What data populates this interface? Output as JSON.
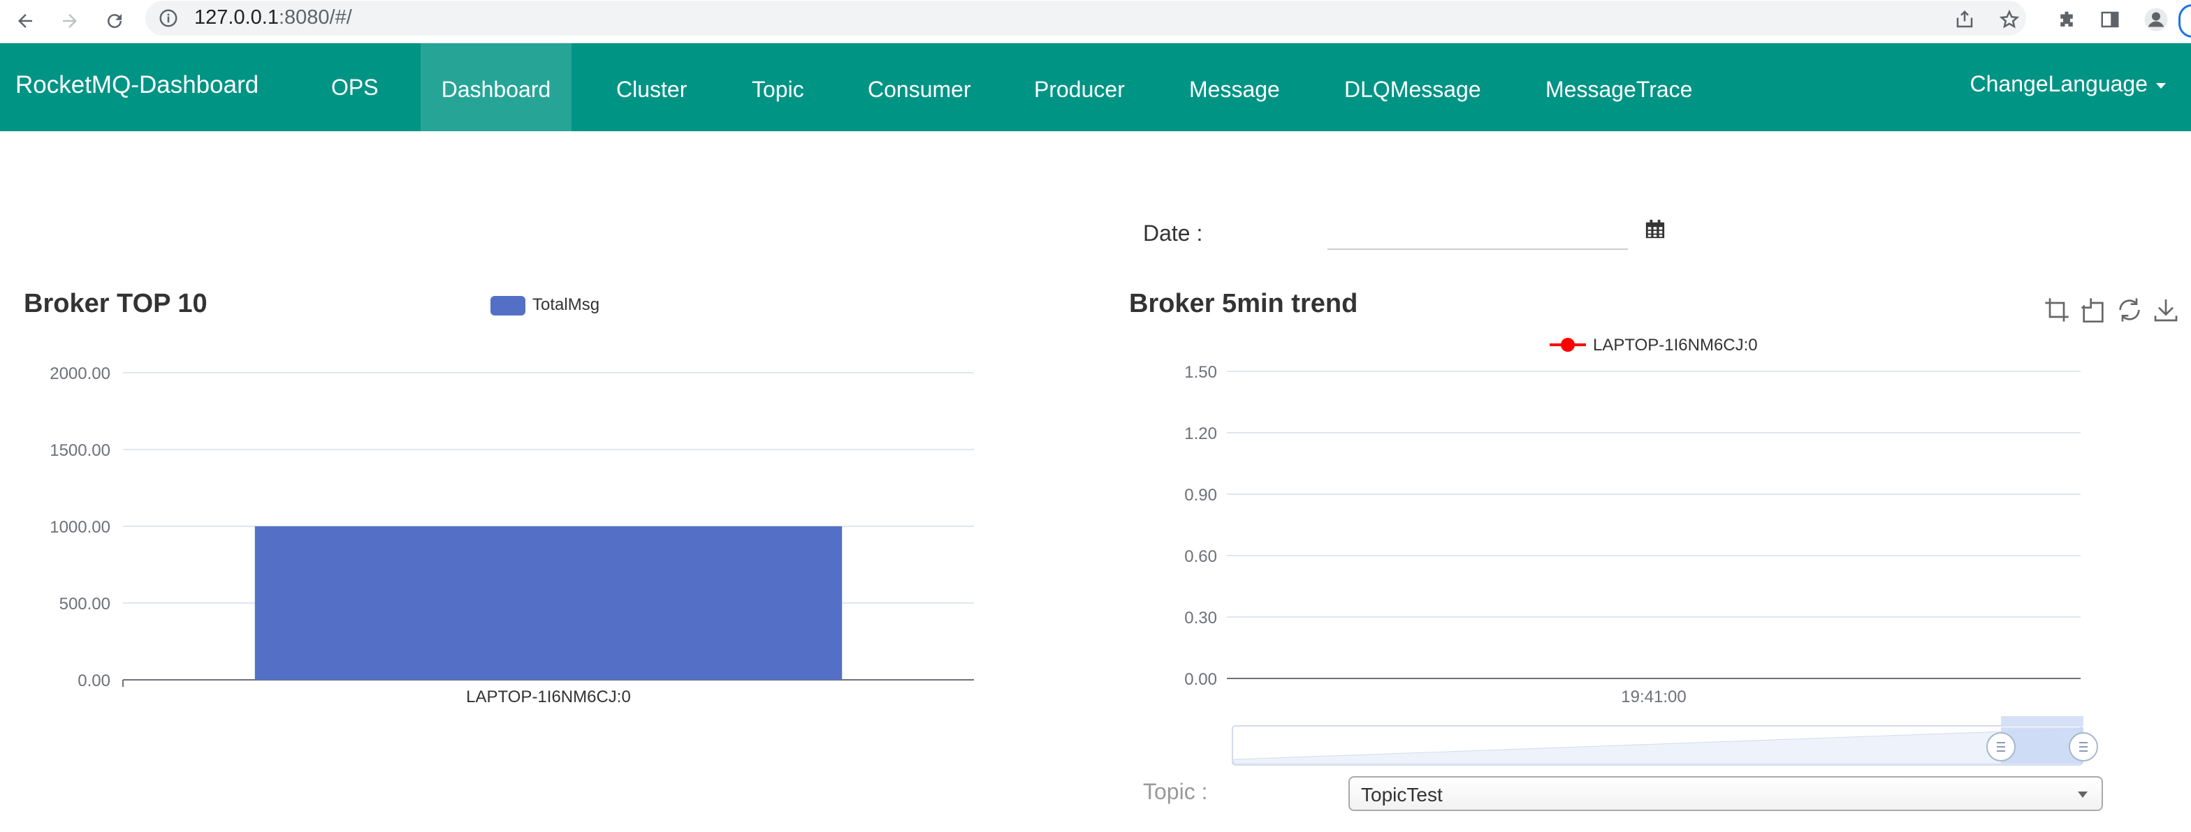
{
  "browser": {
    "url_host": "127.0.0.1",
    "url_rest": ":8080/#/"
  },
  "nav": {
    "brand": "RocketMQ-Dashboard",
    "items": [
      {
        "label": "OPS",
        "name": "nav-ops"
      },
      {
        "label": "Dashboard",
        "name": "nav-dashboard"
      },
      {
        "label": "Cluster",
        "name": "nav-cluster"
      },
      {
        "label": "Topic",
        "name": "nav-topic"
      },
      {
        "label": "Consumer",
        "name": "nav-consumer"
      },
      {
        "label": "Producer",
        "name": "nav-producer"
      },
      {
        "label": "Message",
        "name": "nav-message"
      },
      {
        "label": "DLQMessage",
        "name": "nav-dlqmessage"
      },
      {
        "label": "MessageTrace",
        "name": "nav-messagetrace"
      }
    ],
    "active": "Dashboard",
    "language": "ChangeLanguage"
  },
  "date": {
    "label": "Date :",
    "value": ""
  },
  "topic": {
    "label": "Topic :",
    "selected": "TopicTest"
  },
  "colors": {
    "navbar": "#009485",
    "nav_active": "#26a597",
    "bar": "#5470c6",
    "line": "#ff0000"
  },
  "chart_data": [
    {
      "type": "bar",
      "title": "Broker TOP 10",
      "legend": [
        "TotalMsg"
      ],
      "categories": [
        "LAPTOP-1I6NM6CJ:0"
      ],
      "series": [
        {
          "name": "TotalMsg",
          "values": [
            1000
          ]
        }
      ],
      "ylim": [
        0,
        2000
      ],
      "yticks": [
        "0.00",
        "500.00",
        "1000.00",
        "1500.00",
        "2000.00"
      ],
      "legend_position": "top-center",
      "grid": true
    },
    {
      "type": "line",
      "title": "Broker 5min trend",
      "legend": [
        "LAPTOP-1I6NM6CJ:0"
      ],
      "x": [
        "19:41:00"
      ],
      "series": [
        {
          "name": "LAPTOP-1I6NM6CJ:0",
          "values": []
        }
      ],
      "ylim": [
        0,
        1.5
      ],
      "yticks": [
        "0.00",
        "0.30",
        "0.60",
        "0.90",
        "1.20",
        "1.50"
      ],
      "legend_position": "top-center",
      "grid": true,
      "data_zoom": true
    }
  ]
}
